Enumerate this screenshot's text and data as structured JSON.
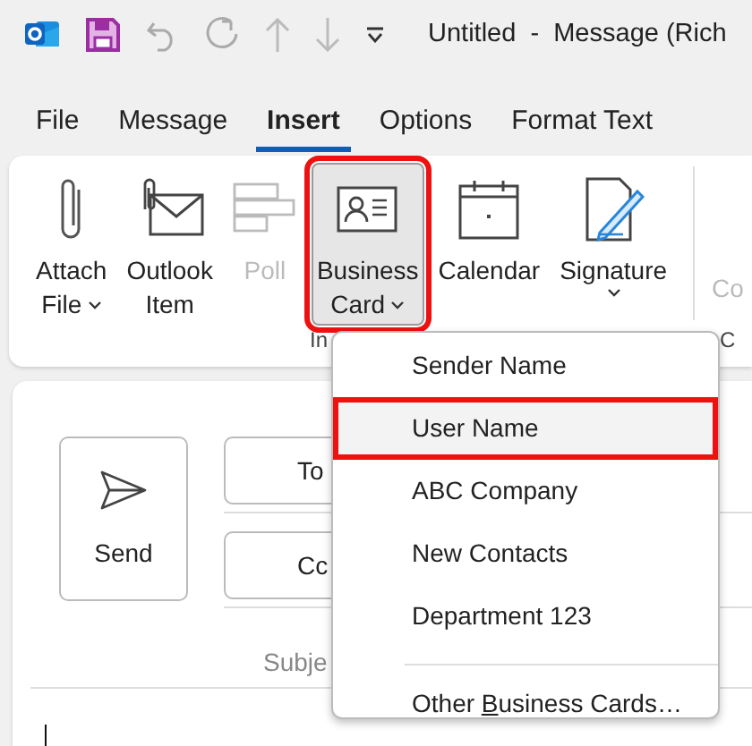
{
  "window": {
    "title": "Untitled  -  Message (Rich"
  },
  "tabs": [
    {
      "label": "File",
      "selected": false
    },
    {
      "label": "Message",
      "selected": false
    },
    {
      "label": "Insert",
      "selected": true
    },
    {
      "label": "Options",
      "selected": false
    },
    {
      "label": "Format Text",
      "selected": false
    }
  ],
  "ribbon": {
    "buttons": [
      {
        "kind": "attach",
        "lines": [
          "Attach",
          "File"
        ],
        "dropdown": true,
        "disabled": false,
        "expanded": false,
        "highlighted": false
      },
      {
        "kind": "outlook-item",
        "lines": [
          "Outlook",
          "Item"
        ],
        "dropdown": false,
        "disabled": false,
        "expanded": false,
        "highlighted": false
      },
      {
        "kind": "poll",
        "lines": [
          "Poll"
        ],
        "dropdown": false,
        "disabled": true,
        "expanded": false,
        "highlighted": false
      },
      {
        "kind": "business-card",
        "lines": [
          "Business",
          "Card"
        ],
        "dropdown": true,
        "disabled": false,
        "expanded": true,
        "highlighted": true
      },
      {
        "kind": "calendar",
        "lines": [
          "Calendar"
        ],
        "dropdown": false,
        "disabled": false,
        "expanded": false,
        "highlighted": false
      },
      {
        "kind": "signature",
        "lines": [
          "Signature"
        ],
        "dropdown": true,
        "disabled": false,
        "expanded": false,
        "highlighted": false
      }
    ],
    "next_button": {
      "label": "Co",
      "disabled": true
    },
    "group_labels": [
      "In",
      "C"
    ]
  },
  "compose": {
    "send": "Send",
    "to": "To",
    "cc": "Cc",
    "subject_label": "Subje"
  },
  "menu": {
    "items": [
      {
        "label_parts": [
          "Sender Name"
        ],
        "hovered": false,
        "highlighted": false
      },
      {
        "label_parts": [
          "User Name"
        ],
        "hovered": true,
        "highlighted": true
      },
      {
        "label_parts": [
          "ABC Company"
        ],
        "hovered": false,
        "highlighted": false
      },
      {
        "label_parts": [
          "New Contacts"
        ],
        "hovered": false,
        "highlighted": false
      },
      {
        "label_parts": [
          "Department 123"
        ],
        "hovered": false,
        "highlighted": false
      },
      {
        "label_parts": [
          "Other ",
          "B",
          "usiness Cards…"
        ],
        "hovered": false,
        "highlighted": false,
        "separated": true
      }
    ]
  }
}
